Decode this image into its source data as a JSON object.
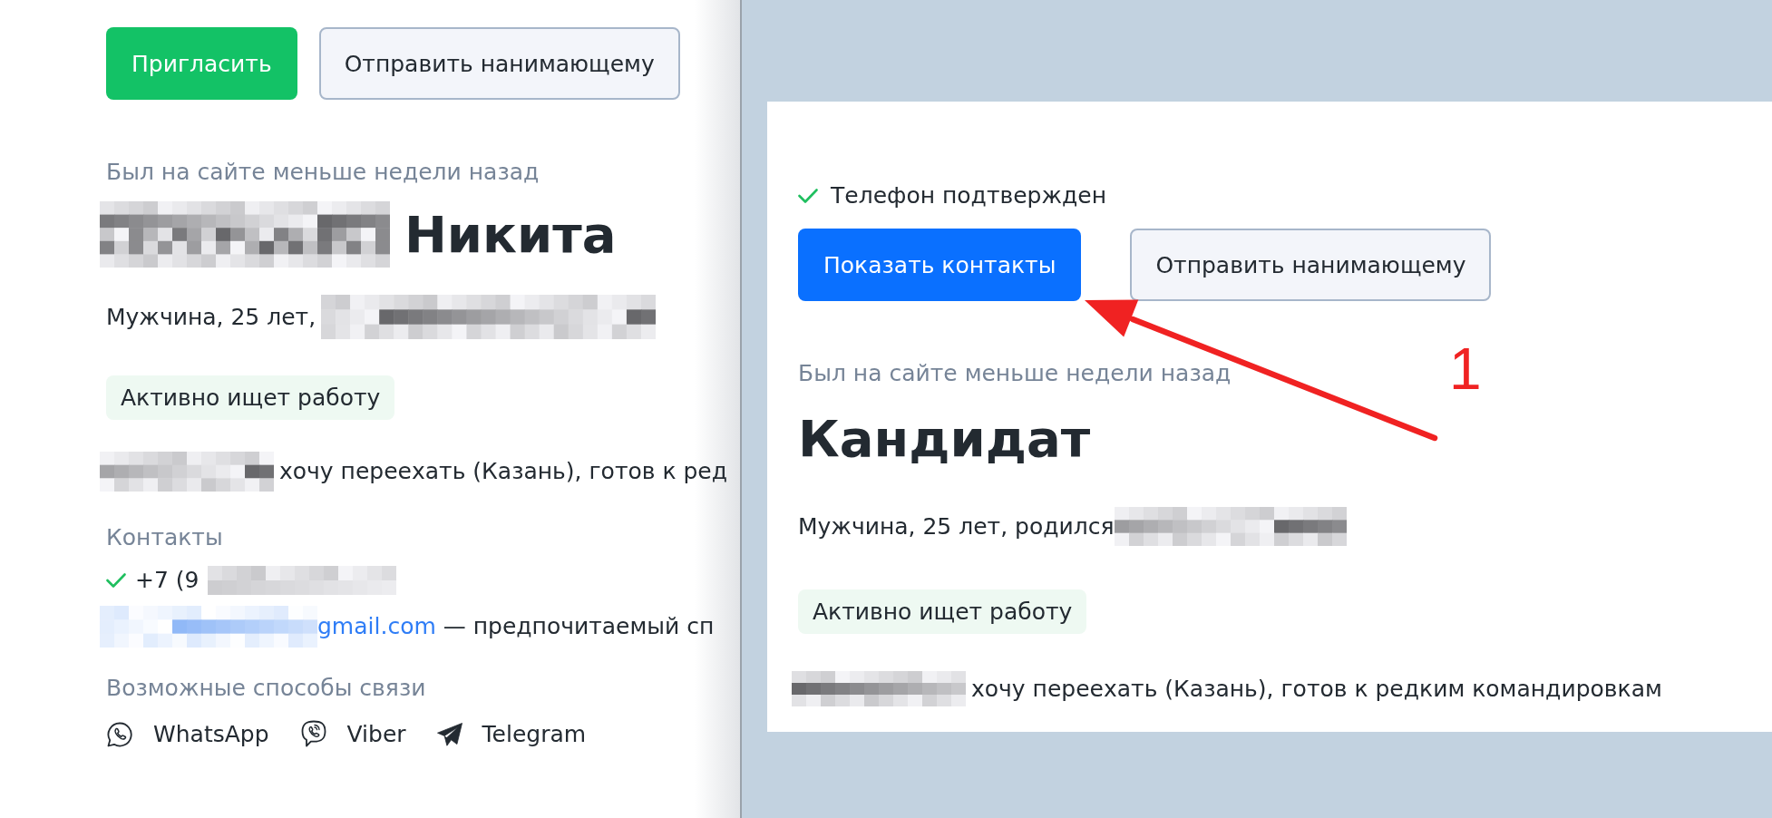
{
  "left_panel": {
    "buttons": [
      {
        "label": "Пригласить",
        "kind": "success"
      },
      {
        "label": "Отправить нанимающему",
        "kind": "secondary"
      }
    ],
    "last_seen": "Был на сайте меньше недели назад",
    "name": {
      "surname_redacted": true,
      "first_name": "Никита"
    },
    "summary": {
      "text": "Мужчина, 25 лет,",
      "redacted": true
    },
    "status_tag": "Активно ищет работу",
    "relocation": {
      "redacted": true,
      "text": "хочу переехать (Казань), готов к ред"
    },
    "contacts": {
      "title": "Контакты",
      "phone": {
        "verified": true,
        "text": "+7 (9",
        "redacted": true
      },
      "email": {
        "redacted": true,
        "link": "gmail.com",
        "note": " — предпочитаемый сп"
      }
    },
    "messengers": {
      "title": "Возможные способы связи",
      "items": [
        {
          "kind": "whatsapp",
          "label": "WhatsApp"
        },
        {
          "kind": "viber",
          "label": "Viber"
        },
        {
          "kind": "telegram",
          "label": "Telegram"
        }
      ]
    }
  },
  "right_panel": {
    "phone_status": {
      "verified": true,
      "text": "Телефон подтвержден"
    },
    "buttons": [
      {
        "label": "Показать контакты",
        "kind": "primary"
      },
      {
        "label": "Отправить нанимающему",
        "kind": "secondary"
      }
    ],
    "last_seen": "Был на сайте меньше недели назад",
    "name": "Кандидат",
    "summary": {
      "text": "Мужчина, 25 лет, родился",
      "redacted": true
    },
    "status_tag": "Активно ищет работу",
    "relocation": {
      "redacted": true,
      "text": "хочу переехать (Казань), готов к редким командировкам"
    }
  },
  "annotation": {
    "label": "1"
  }
}
